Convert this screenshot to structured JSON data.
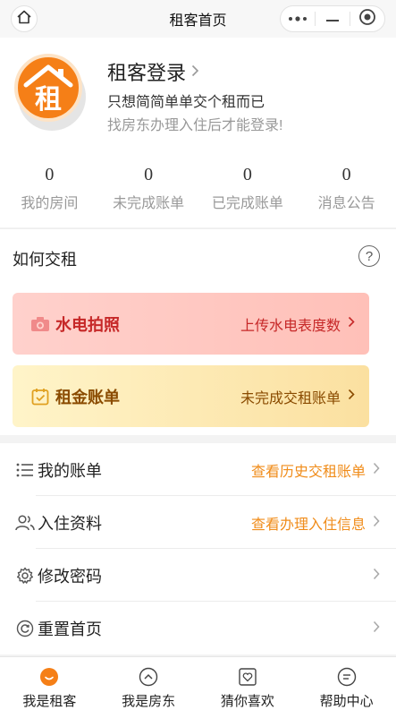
{
  "header": {
    "title": "租客首页"
  },
  "profile": {
    "avatar_char": "租",
    "login_title": "租客登录",
    "subtitle": "只想简简单单交个租而已",
    "hint": "找房东办理入住后才能登录!"
  },
  "stats": [
    {
      "value": "0",
      "label": "我的房间"
    },
    {
      "value": "0",
      "label": "未完成账单"
    },
    {
      "value": "0",
      "label": "已完成账单"
    },
    {
      "value": "0",
      "label": "消息公告"
    }
  ],
  "howto": {
    "title": "如何交租",
    "help_icon": "?",
    "cards": [
      {
        "label": "水电拍照",
        "action": "上传水电表度数",
        "icon": "camera-icon",
        "color": "#c62828"
      },
      {
        "label": "租金账单",
        "action": "未完成交租账单",
        "icon": "calendar-check-icon",
        "color": "#8a4b00"
      }
    ]
  },
  "menu": [
    {
      "label": "我的账单",
      "right": "查看历史交租账单",
      "icon": "list-icon"
    },
    {
      "label": "入住资料",
      "right": "查看办理入住信息",
      "icon": "users-icon"
    },
    {
      "label": "修改密码",
      "right": "",
      "icon": "gear-icon"
    },
    {
      "label": "重置首页",
      "right": "",
      "icon": "refresh-icon"
    }
  ],
  "tabs": [
    {
      "label": "我是租客",
      "icon": "tenant-icon",
      "active": true
    },
    {
      "label": "我是房东",
      "icon": "landlord-icon",
      "active": false
    },
    {
      "label": "猜你喜欢",
      "icon": "heart-icon",
      "active": false
    },
    {
      "label": "帮助中心",
      "icon": "chat-icon",
      "active": false
    }
  ],
  "colors": {
    "accent": "#f57f17",
    "orange_text": "#f08c1a"
  }
}
